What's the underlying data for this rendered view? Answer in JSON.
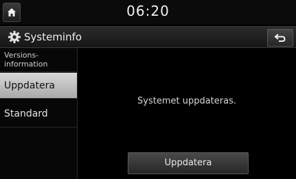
{
  "status_bar": {
    "time": "06:20",
    "home_icon": "home-icon"
  },
  "header": {
    "title": "Systeminfo",
    "settings_icon": "gear-icon",
    "back_icon": "back-arrow-icon"
  },
  "sidebar": {
    "items": [
      {
        "label": "Versions-\ninformation"
      },
      {
        "label": "Uppdatera",
        "selected": true
      },
      {
        "label": "Standard"
      }
    ]
  },
  "main": {
    "status_message": "Systemet uppdateras.",
    "update_button_label": "Uppdatera"
  },
  "colors": {
    "background": "#000000",
    "selected_item": "#c8c8c8",
    "text": "#e8e8e8"
  }
}
